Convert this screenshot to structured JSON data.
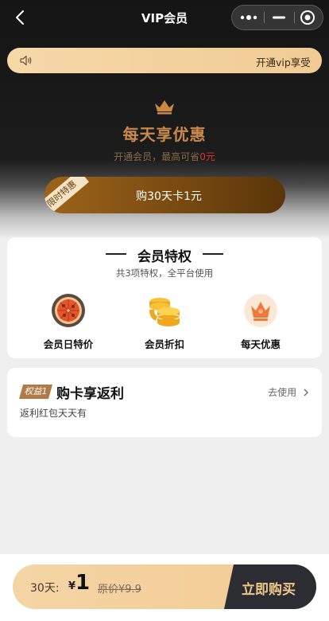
{
  "header": {
    "title": "VIP会员"
  },
  "notice": {
    "text": "开通vip享受"
  },
  "hero": {
    "title": "每天享优惠",
    "subtitle_prefix": "开通会员，最高可省",
    "subtitle_amount": "0元"
  },
  "promo": {
    "ribbon": "限时特惠",
    "label": "购30天卡1元"
  },
  "privileges": {
    "title": "会员特权",
    "subtitle": "共3项特权，全平台使用",
    "items": [
      {
        "label": "会员日特价",
        "icon": "pizza-icon"
      },
      {
        "label": "会员折扣",
        "icon": "coins-icon"
      },
      {
        "label": "每天优惠",
        "icon": "crown-icon"
      }
    ]
  },
  "rebate": {
    "tag": "权益1",
    "title": "购卡享返利",
    "subtitle": "返利红包天天有",
    "action": "去使用"
  },
  "bottom": {
    "days": "30天:",
    "currency": "¥",
    "price": "1",
    "original": "原价¥9.9",
    "cta": "立即购买"
  },
  "colors": {
    "gold": "#f3cb92",
    "dark": "#2b2d33",
    "accent": "#c9894a",
    "red": "#e0342c"
  }
}
